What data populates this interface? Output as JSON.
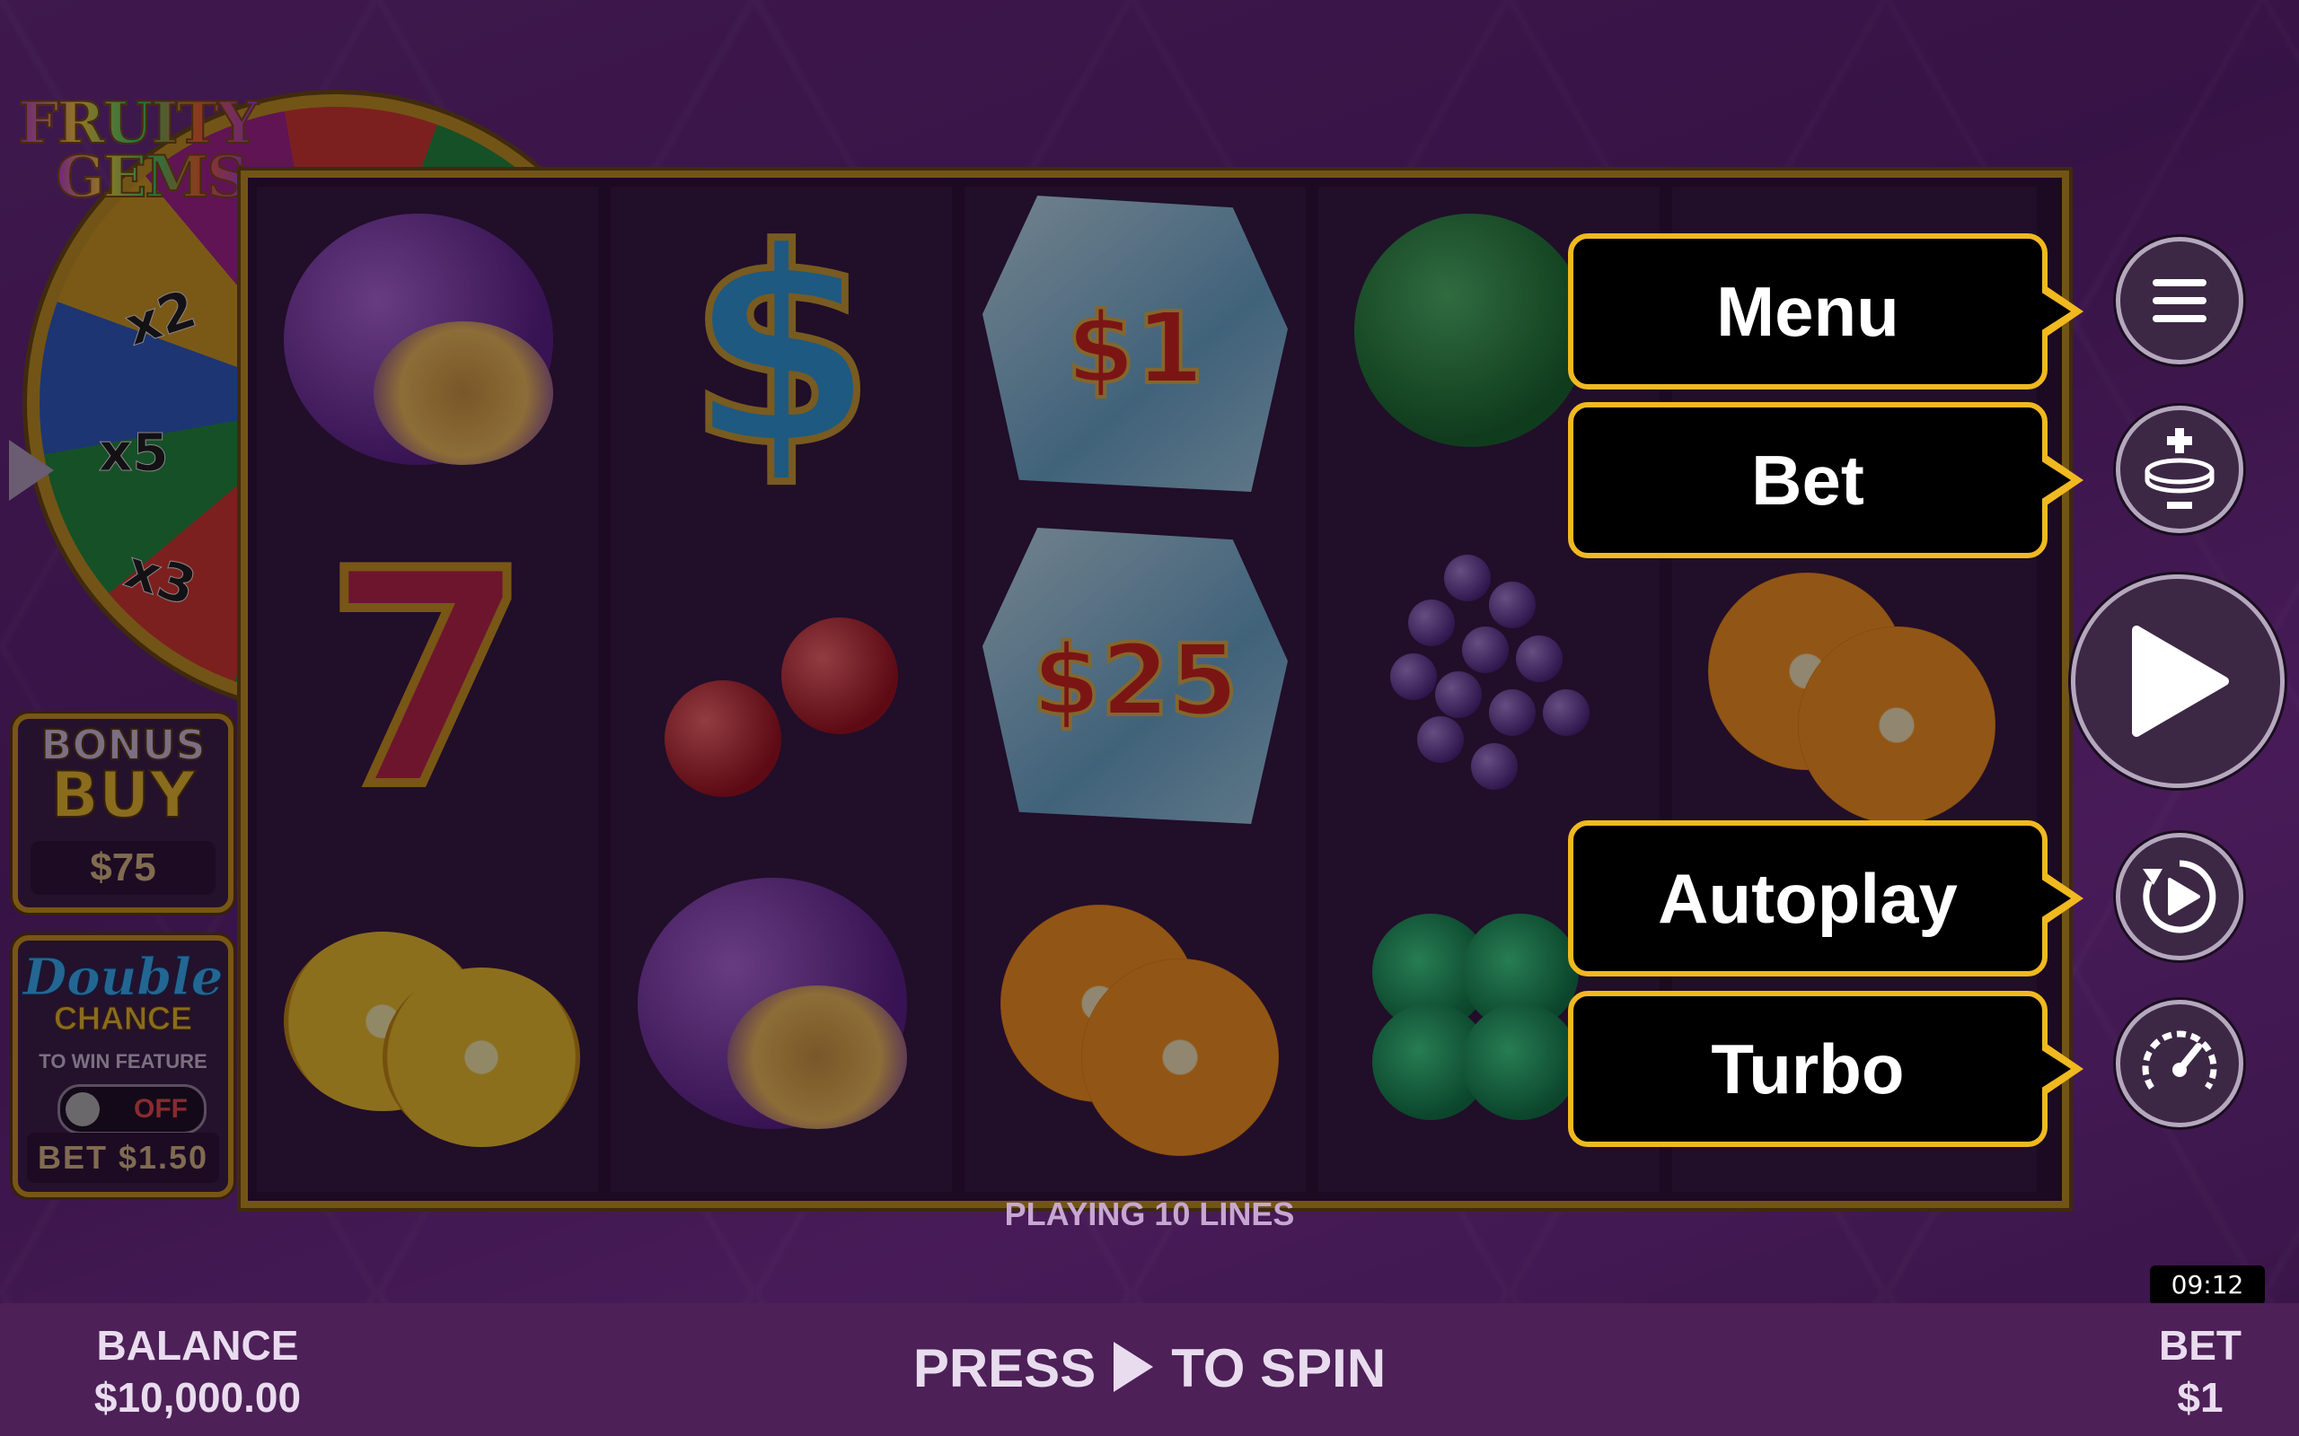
{
  "game": {
    "logo_line1": "FRUITY",
    "logo_line2": "GEMS",
    "wheel_multipliers": [
      "x2",
      "x5",
      "x3"
    ]
  },
  "side_panels": {
    "bonus_buy": {
      "line1": "BONUS",
      "line2": "BUY",
      "price": "$75"
    },
    "double_chance": {
      "line1": "Double",
      "line2": "CHANCE",
      "subtitle": "TO WIN FEATURE",
      "toggle_state": "OFF",
      "bet_label": "BET $1.50"
    }
  },
  "reels": {
    "cash_values": [
      "$1",
      "$25"
    ],
    "dollar_symbol": "$",
    "seven_symbol": "7"
  },
  "menu": {
    "items": [
      {
        "label": "Menu",
        "icon": "hamburger-icon"
      },
      {
        "label": "Bet",
        "icon": "bet-coin-icon"
      },
      {
        "label": "Autoplay",
        "icon": "autoplay-icon"
      },
      {
        "label": "Turbo",
        "icon": "turbo-gauge-icon"
      }
    ],
    "spin_icon": "play-icon"
  },
  "status": {
    "lines": "PLAYING 10 LINES",
    "clock": "09:12"
  },
  "footer": {
    "balance_label": "BALANCE",
    "balance_value": "$10,000.00",
    "press": "PRESS",
    "to_spin": "TO SPIN",
    "bet_label": "BET",
    "bet_value": "$1"
  },
  "colors": {
    "background": "#6a2a82",
    "gold_accent": "#f0b920",
    "footer": "#4d2057"
  }
}
